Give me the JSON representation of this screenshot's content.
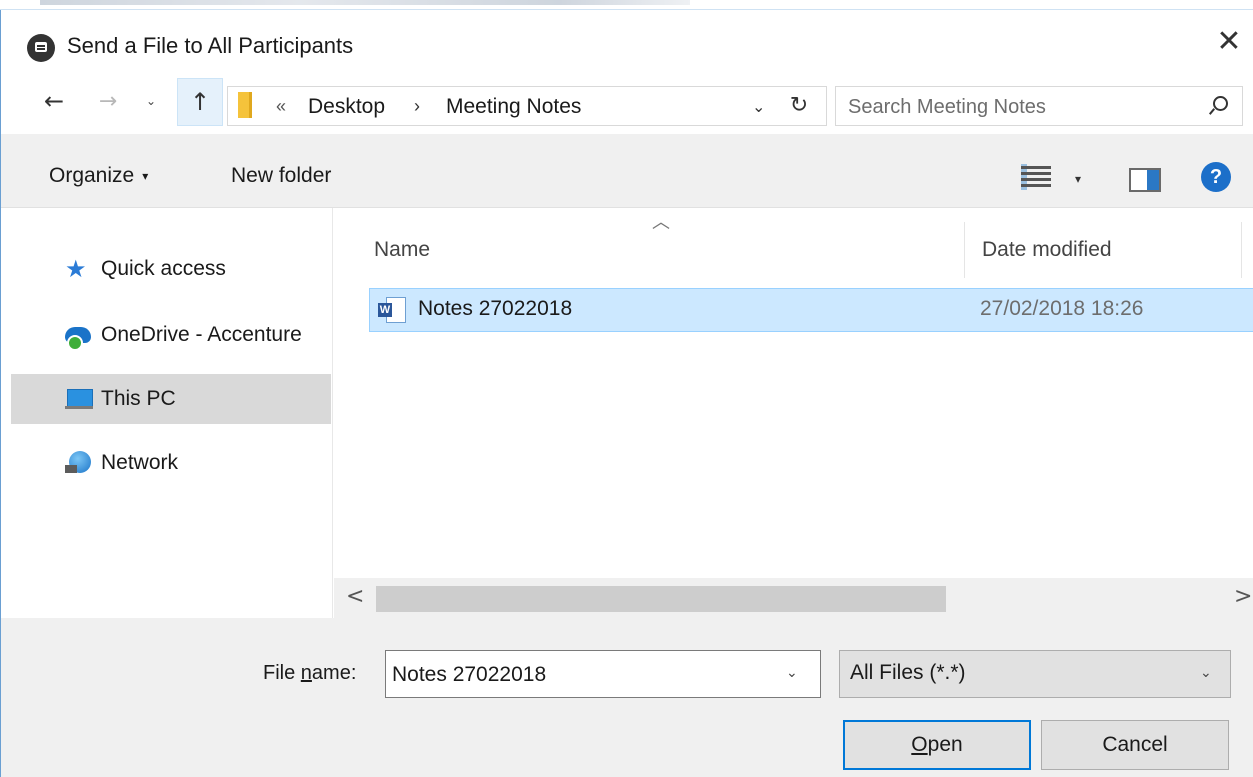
{
  "window": {
    "title": "Send a File to All Participants",
    "close_glyph": "✕"
  },
  "nav": {
    "back_glyph": "←",
    "forward_glyph": "→",
    "recent_glyph": "⌄",
    "up_glyph": "↑",
    "breadcrumb_chevron": "«",
    "breadcrumb": [
      "Desktop",
      "Meeting Notes"
    ],
    "breadcrumb_separator": "›",
    "address_dropdown_glyph": "⌄",
    "refresh_glyph": "↻",
    "search_placeholder": "Search Meeting Notes"
  },
  "toolbar": {
    "organize_label": "Organize",
    "organize_caret": "▾",
    "new_folder_label": "New folder",
    "view_caret": "▾",
    "help_label": "?"
  },
  "sidebar": {
    "items": [
      {
        "label": "Quick access",
        "icon": "star-icon"
      },
      {
        "label": "OneDrive - Accenture",
        "icon": "onedrive-icon"
      },
      {
        "label": "This PC",
        "icon": "this-pc-icon",
        "selected": true
      },
      {
        "label": "Network",
        "icon": "network-icon"
      }
    ],
    "star_glyph": "★"
  },
  "file_list": {
    "sort_glyph": "︿",
    "columns": {
      "name": "Name",
      "date_modified": "Date modified"
    },
    "rows": [
      {
        "name": "Notes 27022018",
        "date_modified": "27/02/2018 18:26",
        "icon": "word-doc-icon",
        "icon_letter": "W",
        "selected": true
      }
    ]
  },
  "hscroll": {
    "left_glyph": "<",
    "right_glyph": ">"
  },
  "bottom": {
    "file_name_label_pre": "File ",
    "file_name_label_accel": "n",
    "file_name_label_post": "ame:",
    "file_name_value": "Notes 27022018",
    "file_name_dropdown_glyph": "⌄",
    "file_type_value": "All Files (*.*)",
    "file_type_dropdown_glyph": "⌄",
    "open_accel": "O",
    "open_rest": "pen",
    "cancel_label": "Cancel"
  },
  "colors": {
    "selection_bg": "#cce8ff",
    "selection_border": "#99d1ff",
    "accent": "#0078d7",
    "help_blue": "#1c6fc9"
  }
}
